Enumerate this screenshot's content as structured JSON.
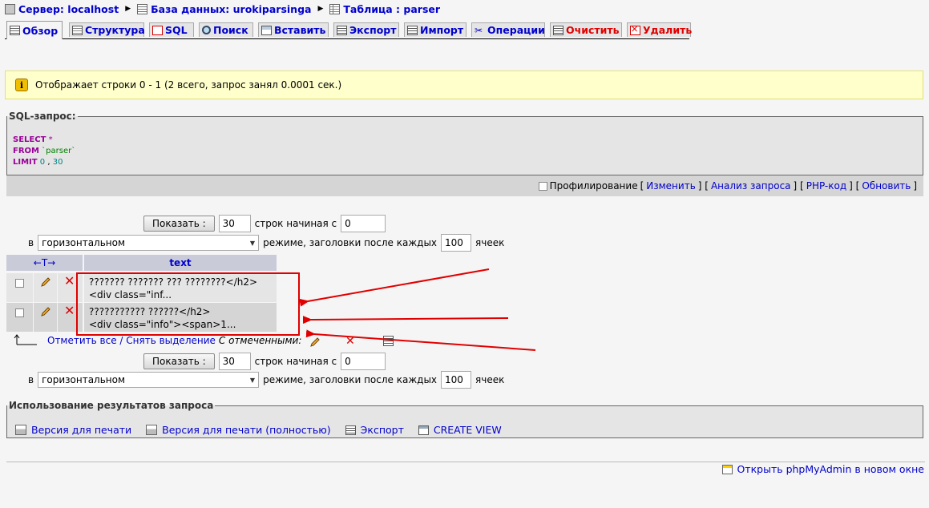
{
  "breadcrumb": {
    "server": "Сервер: localhost",
    "database": "База данных: urokiparsinga",
    "table": "Таблица : parser"
  },
  "tabs": [
    {
      "label": "Обзор",
      "icon": "browse-icon",
      "active": true
    },
    {
      "label": "Структура",
      "icon": "structure-icon"
    },
    {
      "label": "SQL",
      "icon": "sql-icon"
    },
    {
      "label": "Поиск",
      "icon": "search-icon"
    },
    {
      "label": "Вставить",
      "icon": "insert-icon"
    },
    {
      "label": "Экспорт",
      "icon": "export-icon"
    },
    {
      "label": "Импорт",
      "icon": "import-icon"
    },
    {
      "label": "Операции",
      "icon": "operations-icon"
    },
    {
      "label": "Очистить",
      "icon": "empty-icon",
      "danger": true
    },
    {
      "label": "Удалить",
      "icon": "drop-icon",
      "danger": true
    }
  ],
  "notice": {
    "text": "Отображает строки 0 - 1 (2 всего, запрос занял 0.0001 сек.)"
  },
  "sql_box": {
    "legend": "SQL-запрос:",
    "select_kw": "SELECT",
    "select_val": "*",
    "from_kw": "FROM",
    "from_val": "`parser`",
    "limit_kw": "LIMIT",
    "limit_a": "0",
    "limit_comma": ",",
    "limit_b": "30",
    "profiling_label": "Профилирование",
    "links": [
      "Изменить",
      "Анализ запроса",
      "PHP-код",
      "Обновить"
    ]
  },
  "nav_top": {
    "show_button": "Показать :",
    "rows_count": "30",
    "rows_label": "строк начиная с",
    "start_value": "0",
    "in_label": "в",
    "mode_value": "горизонтальном",
    "mode_label": "режиме, заголовки после каждых",
    "repeat_value": "100",
    "cells_label": "ячеек"
  },
  "nav_bottom": {
    "show_button": "Показать :",
    "rows_count": "30",
    "rows_label": "строк начиная с",
    "start_value": "0",
    "in_label": "в",
    "mode_value": "горизонтальном",
    "mode_label": "режиме, заголовки после каждых",
    "repeat_value": "100",
    "cells_label": "ячеек"
  },
  "results": {
    "sort_arrows": "←T→",
    "column": "text",
    "rows": [
      {
        "line1": "??????? ??????? ??? ????????</h2>",
        "line2": "<div class=\"inf..."
      },
      {
        "line1": "??????????? ??????</h2>",
        "line2": "<div class=\"info\"><span>1..."
      }
    ],
    "check_all": "Отметить все",
    "slash": " / ",
    "uncheck_all": "Снять выделение",
    "with_selected": "С отмеченными:"
  },
  "usage": {
    "legend": "Использование результатов запроса",
    "items": [
      "Версия для печати",
      "Версия для печати (полностью)",
      "Экспорт",
      "CREATE VIEW"
    ]
  },
  "footer": {
    "open_link": "Открыть phpMyAdmin в новом окне"
  },
  "colors": {
    "link": "#0000cc",
    "danger": "#e00000",
    "notice_bg": "#ffffcc",
    "annotation": "#e00000"
  }
}
